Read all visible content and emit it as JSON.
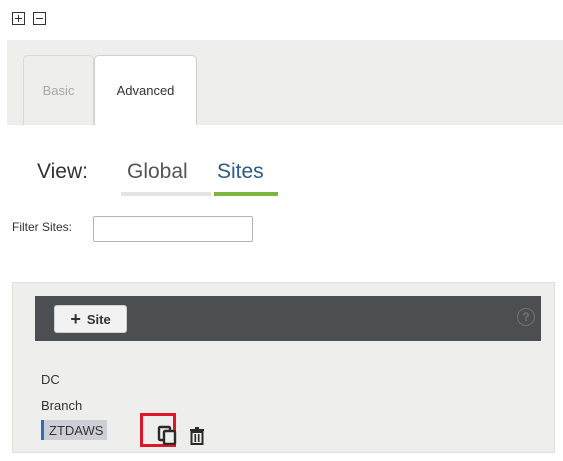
{
  "toolbar": {
    "expand_icon": "plus-square-icon",
    "collapse_icon": "minus-square-icon"
  },
  "tabs": [
    {
      "label": "Basic",
      "active": false
    },
    {
      "label": "Advanced",
      "active": true
    }
  ],
  "view": {
    "label": "View:",
    "options": [
      {
        "label": "Global",
        "active": false
      },
      {
        "label": "Sites",
        "active": true
      }
    ],
    "active_color": "#7ab640"
  },
  "filter": {
    "label": "Filter Sites:",
    "value": "",
    "placeholder": ""
  },
  "sites_panel": {
    "add_button_label": "Site",
    "help_icon": "question-circle-icon",
    "help_label": "?",
    "sites": [
      {
        "name": "DC",
        "selected": false
      },
      {
        "name": "Branch",
        "selected": false
      },
      {
        "name": "ZTDAWS",
        "selected": true
      }
    ],
    "actions": {
      "copy_icon": "copy-icon",
      "delete_icon": "trash-icon"
    },
    "highlight_color": "#e0162b"
  }
}
